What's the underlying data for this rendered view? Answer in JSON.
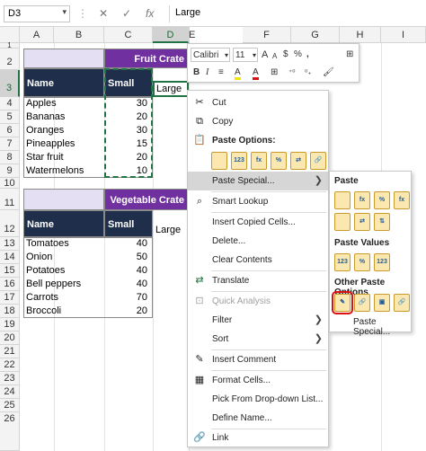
{
  "formula_bar": {
    "name_box": "D3",
    "name_arrow": "▾",
    "cancel": "✕",
    "enter": "✓",
    "fx": "fx",
    "value": "Large"
  },
  "columns": [
    "A",
    "B",
    "C",
    "D",
    "E",
    "F",
    "G",
    "H",
    "I"
  ],
  "rows": [
    "1",
    "2",
    "3",
    "4",
    "5",
    "6",
    "7",
    "8",
    "9",
    "10",
    "11",
    "12",
    "13",
    "14",
    "15",
    "16",
    "17",
    "18",
    "19",
    "20",
    "21",
    "22",
    "23",
    "24",
    "25",
    "26"
  ],
  "sheet": {
    "table1": {
      "title": "Fruit Crate",
      "col_name": "Name",
      "col_small": "Small",
      "col_large": "Large",
      "rows": [
        {
          "name": "Apples",
          "small": "30"
        },
        {
          "name": "Bananas",
          "small": "20"
        },
        {
          "name": "Oranges",
          "small": "30"
        },
        {
          "name": "Pineapples",
          "small": "15"
        },
        {
          "name": "Star fruit",
          "small": "20"
        },
        {
          "name": "Watermelons",
          "small": "10"
        }
      ]
    },
    "table2": {
      "title": "Vegetable Crate",
      "col_name": "Name",
      "col_small": "Small",
      "col_large": "Large",
      "rows": [
        {
          "name": "Tomatoes",
          "small": "40"
        },
        {
          "name": "Onion",
          "small": "50"
        },
        {
          "name": "Potatoes",
          "small": "40"
        },
        {
          "name": "Bell peppers",
          "small": "40"
        },
        {
          "name": "Carrots",
          "small": "70"
        },
        {
          "name": "Broccoli",
          "small": "20"
        }
      ]
    }
  },
  "mini_toolbar": {
    "font": "Calibri",
    "size": "11",
    "grow": "A",
    "shrink": "A",
    "currency": "$",
    "percent": "%",
    "comma": ",",
    "bold": "B",
    "italic": "I",
    "align": "≡",
    "highlight_letter": "A",
    "font_color": "A",
    "borders": "⊞",
    "dec_more": "⁺⁰",
    "dec_less": "⁰₊",
    "format_painter": "🖌",
    "dropdown": "▾"
  },
  "context_menu": {
    "cut": "Cut",
    "copy": "Copy",
    "paste_options": "Paste Options:",
    "paste_special": "Paste Special...",
    "smart_lookup": "Smart Lookup",
    "insert_copied": "Insert Copied Cells...",
    "delete": "Delete...",
    "clear_contents": "Clear Contents",
    "translate": "Translate",
    "quick_analysis": "Quick Analysis",
    "filter": "Filter",
    "sort": "Sort",
    "insert_comment": "Insert Comment",
    "format_cells": "Format Cells...",
    "pick_dropdown": "Pick From Drop-down List...",
    "define_name": "Define Name...",
    "link": "Link",
    "submenu_arrow": "❯",
    "icons": {
      "cut": "✂",
      "copy": "⧉",
      "paste": "📋",
      "smart_lookup": "⌕",
      "translate": "⇄",
      "quick_analysis": "⊡",
      "insert_comment": "✎",
      "format_cells": "▦",
      "link": "🔗"
    },
    "paste_option_icons": [
      "",
      "123",
      "fx",
      "%",
      "⇄",
      "🔗"
    ]
  },
  "submenu": {
    "paste": "Paste",
    "paste_values": "Paste Values",
    "other": "Other Paste Options",
    "paste_special": "Paste Special...",
    "paste_icons": [
      "",
      "fx",
      "%",
      "fx",
      "",
      "⇄",
      "⇅",
      "⇆"
    ],
    "value_icons": [
      "123",
      "%",
      "123"
    ],
    "other_icons": [
      "✎",
      "🔗",
      "▣",
      "🔗"
    ]
  },
  "colors": {
    "accent_green": "#217346",
    "purple": "#7030a0",
    "navy": "#1f2f4b",
    "lavender": "#e4dff3",
    "selection_red": "#d11111"
  }
}
